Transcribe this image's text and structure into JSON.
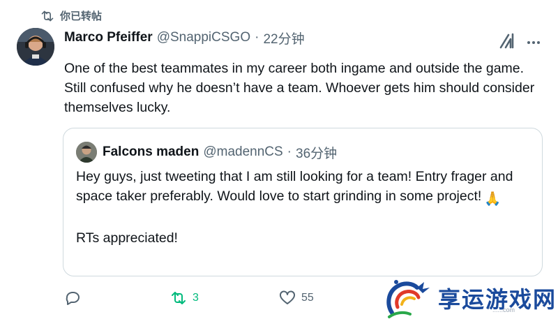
{
  "retweet_bar": {
    "label": "你已转帖",
    "icon": "retweet-icon"
  },
  "tweet": {
    "author": {
      "name": "Marco Pfeiffer",
      "handle": "@SnappiCSGO",
      "separator": "·",
      "time": "22分钟"
    },
    "text": "One of the best teammates in my career both ingame and outside the game. Still confused why he doesn’t have a team. Whoever gets him should consider themselves lucky.",
    "icons": {
      "grok": "grok-icon",
      "more": "more-icon"
    }
  },
  "quote": {
    "author": {
      "name": "Falcons maden",
      "handle": "@madennCS",
      "separator": "·",
      "time": "36分钟"
    },
    "lines": [
      "Hey guys, just tweeting that I am still looking for a team! Entry frager and space taker preferably. Would love to start grinding in some project!",
      "",
      "RTs appreciated!"
    ],
    "emoji": "🙏"
  },
  "actions": {
    "reply": {
      "icon": "reply-icon",
      "count": ""
    },
    "retweet": {
      "icon": "retweet-icon",
      "count": "3",
      "active_color": "#00ba7c"
    },
    "like": {
      "icon": "heart-icon",
      "count": "55"
    }
  },
  "watermark": {
    "text": "享运游戏网",
    "sub": "......com"
  },
  "colors": {
    "text": "#0f1419",
    "muted": "#536471",
    "border": "#cfd9de",
    "retweet_green": "#00ba7c",
    "watermark_blue": "#1a4a9c"
  }
}
